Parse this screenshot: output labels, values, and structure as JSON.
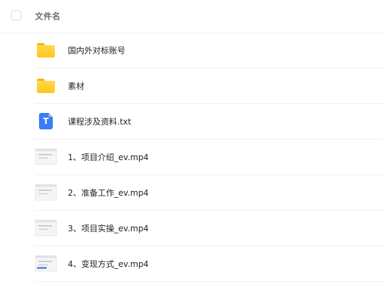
{
  "header": {
    "title": "文件名"
  },
  "files": [
    {
      "name": "国内外对标账号",
      "type": "folder",
      "icon": "folder-icon"
    },
    {
      "name": "素材",
      "type": "folder",
      "icon": "folder-icon"
    },
    {
      "name": "课程涉及资料.txt",
      "type": "txt",
      "icon": "txt-file-icon",
      "icon_letter": "T"
    },
    {
      "name": "1、项目介绍_ev.mp4",
      "type": "video",
      "icon": "video-thumbnail"
    },
    {
      "name": "2、准备工作_ev.mp4",
      "type": "video",
      "icon": "video-thumbnail"
    },
    {
      "name": "3、项目实操_ev.mp4",
      "type": "video",
      "icon": "video-thumbnail"
    },
    {
      "name": "4、变现方式_ev.mp4",
      "type": "video",
      "icon": "video-thumbnail"
    }
  ],
  "colors": {
    "folder": "#ffc61a",
    "txt_icon": "#3d7cf5",
    "divider": "#eeeeee"
  }
}
